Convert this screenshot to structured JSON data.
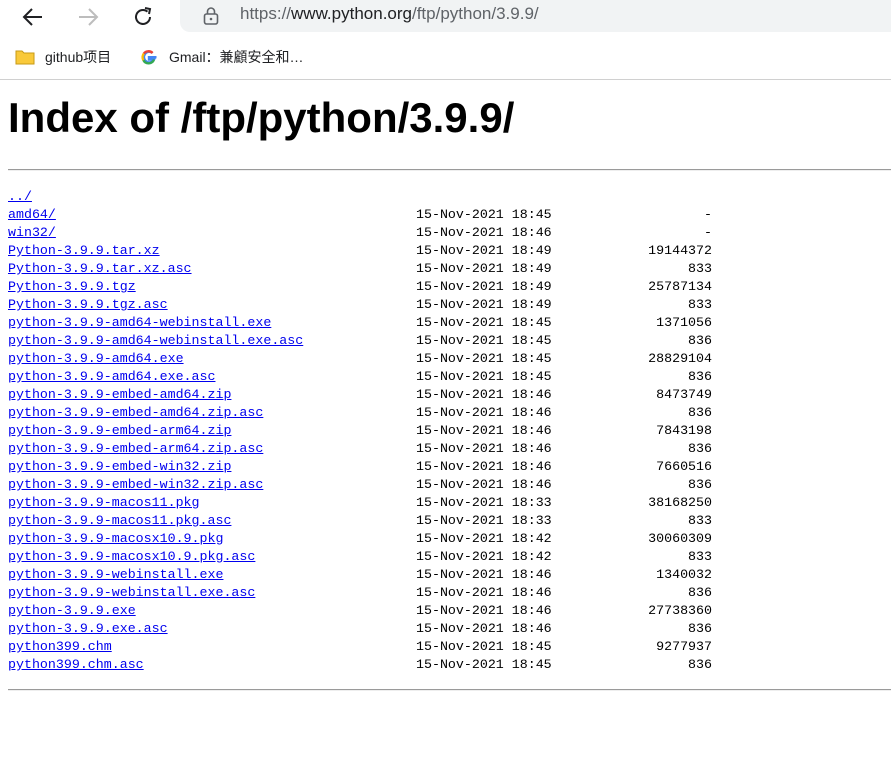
{
  "browser": {
    "url_prefix": "https://",
    "url_host": "www.python.org",
    "url_path": "/ftp/python/3.9.9/",
    "bookmarks": [
      {
        "label": "github项目",
        "icon": "folder-icon"
      },
      {
        "label": "Gmail：兼顧安全和…",
        "icon": "google-icon"
      }
    ]
  },
  "page": {
    "title": "Index of /ftp/python/3.9.9/"
  },
  "listing": {
    "parent": "../",
    "entries": [
      {
        "name": "amd64/",
        "date": "15-Nov-2021 18:45",
        "size": "-"
      },
      {
        "name": "win32/",
        "date": "15-Nov-2021 18:46",
        "size": "-"
      },
      {
        "name": "Python-3.9.9.tar.xz",
        "date": "15-Nov-2021 18:49",
        "size": "19144372"
      },
      {
        "name": "Python-3.9.9.tar.xz.asc",
        "date": "15-Nov-2021 18:49",
        "size": "833"
      },
      {
        "name": "Python-3.9.9.tgz",
        "date": "15-Nov-2021 18:49",
        "size": "25787134"
      },
      {
        "name": "Python-3.9.9.tgz.asc",
        "date": "15-Nov-2021 18:49",
        "size": "833"
      },
      {
        "name": "python-3.9.9-amd64-webinstall.exe",
        "date": "15-Nov-2021 18:45",
        "size": "1371056"
      },
      {
        "name": "python-3.9.9-amd64-webinstall.exe.asc",
        "date": "15-Nov-2021 18:45",
        "size": "836"
      },
      {
        "name": "python-3.9.9-amd64.exe",
        "date": "15-Nov-2021 18:45",
        "size": "28829104"
      },
      {
        "name": "python-3.9.9-amd64.exe.asc",
        "date": "15-Nov-2021 18:45",
        "size": "836"
      },
      {
        "name": "python-3.9.9-embed-amd64.zip",
        "date": "15-Nov-2021 18:46",
        "size": "8473749"
      },
      {
        "name": "python-3.9.9-embed-amd64.zip.asc",
        "date": "15-Nov-2021 18:46",
        "size": "836"
      },
      {
        "name": "python-3.9.9-embed-arm64.zip",
        "date": "15-Nov-2021 18:46",
        "size": "7843198"
      },
      {
        "name": "python-3.9.9-embed-arm64.zip.asc",
        "date": "15-Nov-2021 18:46",
        "size": "836"
      },
      {
        "name": "python-3.9.9-embed-win32.zip",
        "date": "15-Nov-2021 18:46",
        "size": "7660516"
      },
      {
        "name": "python-3.9.9-embed-win32.zip.asc",
        "date": "15-Nov-2021 18:46",
        "size": "836"
      },
      {
        "name": "python-3.9.9-macos11.pkg",
        "date": "15-Nov-2021 18:33",
        "size": "38168250"
      },
      {
        "name": "python-3.9.9-macos11.pkg.asc",
        "date": "15-Nov-2021 18:33",
        "size": "833"
      },
      {
        "name": "python-3.9.9-macosx10.9.pkg",
        "date": "15-Nov-2021 18:42",
        "size": "30060309"
      },
      {
        "name": "python-3.9.9-macosx10.9.pkg.asc",
        "date": "15-Nov-2021 18:42",
        "size": "833"
      },
      {
        "name": "python-3.9.9-webinstall.exe",
        "date": "15-Nov-2021 18:46",
        "size": "1340032"
      },
      {
        "name": "python-3.9.9-webinstall.exe.asc",
        "date": "15-Nov-2021 18:46",
        "size": "836"
      },
      {
        "name": "python-3.9.9.exe",
        "date": "15-Nov-2021 18:46",
        "size": "27738360"
      },
      {
        "name": "python-3.9.9.exe.asc",
        "date": "15-Nov-2021 18:46",
        "size": "836"
      },
      {
        "name": "python399.chm",
        "date": "15-Nov-2021 18:45",
        "size": "9277937"
      },
      {
        "name": "python399.chm.asc",
        "date": "15-Nov-2021 18:45",
        "size": "836"
      }
    ]
  },
  "colors": {
    "link": "#0000ee",
    "address_bar_bg": "#f1f3f4"
  }
}
